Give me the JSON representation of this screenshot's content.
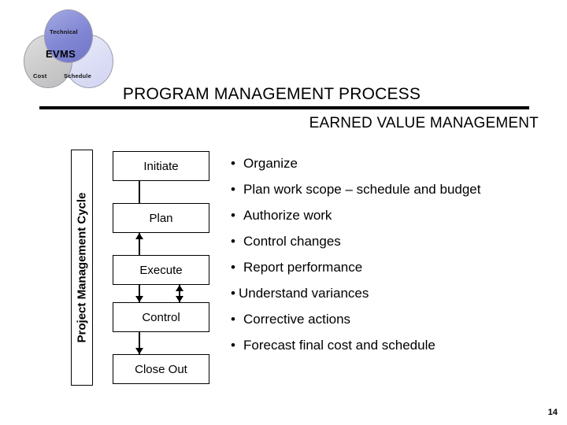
{
  "slide": {
    "page_number": "14"
  },
  "logo": {
    "center_label": "EVMS",
    "circles": [
      {
        "label": "Technical",
        "color": "#8086d2"
      },
      {
        "label": "Cost",
        "color": "#cbcbcb"
      },
      {
        "label": "Schedule",
        "color": "#dcdef6"
      }
    ]
  },
  "header": {
    "title": "PROGRAM MANAGEMENT PROCESS",
    "subtitle": "EARNED VALUE MANAGEMENT"
  },
  "flowchart": {
    "axis_label": "Project Management Cycle",
    "steps": [
      {
        "label": "Initiate"
      },
      {
        "label": "Plan"
      },
      {
        "label": "Execute"
      },
      {
        "label": "Control"
      },
      {
        "label": "Close Out"
      }
    ]
  },
  "bullets": {
    "marker": "•",
    "items": [
      {
        "text": "Organize",
        "tight": false
      },
      {
        "text": "Plan work scope – schedule and budget",
        "tight": false
      },
      {
        "text": "Authorize work",
        "tight": false
      },
      {
        "text": "Control changes",
        "tight": false
      },
      {
        "text": "Report performance",
        "tight": false
      },
      {
        "text": "Understand variances",
        "tight": true
      },
      {
        "text": "Corrective actions",
        "tight": false
      },
      {
        "text": "Forecast final cost and schedule",
        "tight": false
      }
    ]
  }
}
